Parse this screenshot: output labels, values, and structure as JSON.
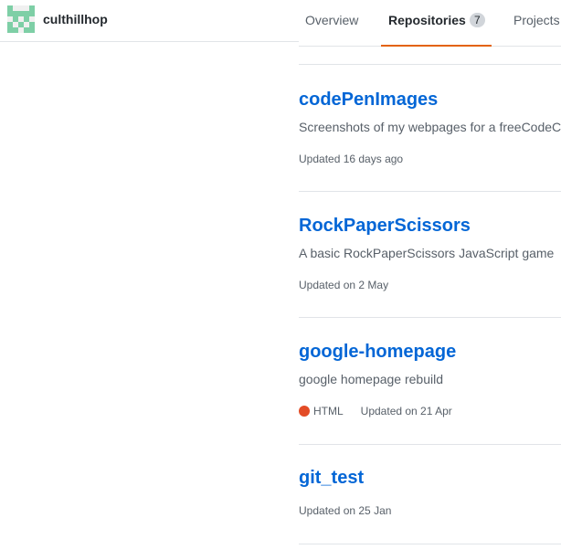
{
  "user": {
    "username": "culthillhop",
    "avatar_colors": {
      "fill": "#7ecfa6",
      "background": "#f0f0f0"
    }
  },
  "tabs": [
    {
      "label": "Overview",
      "active": false
    },
    {
      "label": "Repositories",
      "count": "7",
      "active": true
    },
    {
      "label": "Projects",
      "active": false
    }
  ],
  "colors": {
    "link": "#0366d6",
    "active_tab_underline": "#e36209",
    "muted_text": "#586069"
  },
  "repositories": [
    {
      "name": "codePenImages",
      "description": "Screenshots of my webpages for a freeCodeCamp",
      "updated": "Updated 16 days ago"
    },
    {
      "name": "RockPaperScissors",
      "description": "A basic RockPaperScissors JavaScript game",
      "updated": "Updated on 2 May"
    },
    {
      "name": "google-homepage",
      "description": "google homepage rebuild",
      "language": "HTML",
      "language_color": "#e34c26",
      "updated": "Updated on 21 Apr"
    },
    {
      "name": "git_test",
      "updated": "Updated on 25 Jan"
    }
  ]
}
